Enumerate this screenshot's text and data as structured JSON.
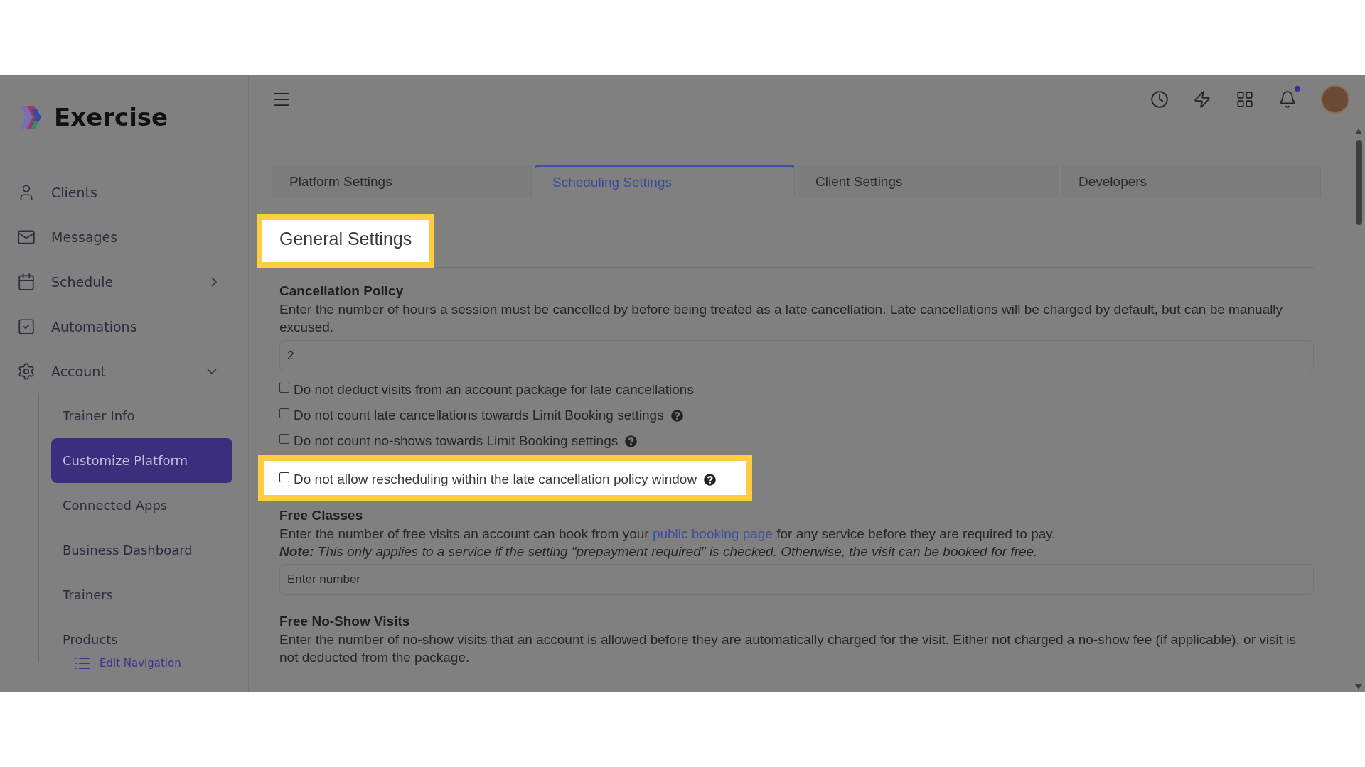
{
  "logo": {
    "text": "Exercise"
  },
  "nav": [
    {
      "label": "Clients",
      "kind": "link"
    },
    {
      "label": "Messages",
      "kind": "link"
    },
    {
      "label": "Schedule",
      "kind": "group",
      "expanded": false
    },
    {
      "label": "Automations",
      "kind": "link"
    },
    {
      "label": "Account",
      "kind": "group",
      "expanded": true,
      "children": [
        {
          "label": "Trainer Info",
          "selected": false
        },
        {
          "label": "Customize Platform",
          "selected": true
        },
        {
          "label": "Connected Apps",
          "selected": false
        },
        {
          "label": "Business Dashboard",
          "selected": false
        },
        {
          "label": "Trainers",
          "selected": false
        },
        {
          "label": "Products",
          "selected": false
        }
      ]
    }
  ],
  "edit_navigation": "Edit Navigation",
  "topbar": {
    "notification_dot": true
  },
  "tabs": [
    {
      "label": "Platform Settings",
      "selected": false
    },
    {
      "label": "Scheduling Settings",
      "selected": true
    },
    {
      "label": "Client Settings",
      "selected": false
    },
    {
      "label": "Developers",
      "selected": false
    }
  ],
  "section": {
    "title": "General Settings",
    "highlighted": true
  },
  "cancellation_policy": {
    "heading": "Cancellation Policy",
    "description": "Enter the number of hours a session must be cancelled by before being treated as a late cancellation. Late cancellations will be charged by default, but can be manually excused.",
    "value": "2",
    "options": [
      {
        "label": "Do not deduct visits from an account package for late cancellations",
        "checked": false,
        "help": false,
        "highlighted": false
      },
      {
        "label": "Do not count late cancellations towards Limit Booking settings",
        "checked": false,
        "help": true,
        "highlighted": false
      },
      {
        "label": "Do not count no-shows towards Limit Booking settings",
        "checked": false,
        "help": true,
        "highlighted": false
      },
      {
        "label": "Do not allow rescheduling within the late cancellation policy window",
        "checked": false,
        "help": true,
        "highlighted": true
      }
    ]
  },
  "free_classes": {
    "heading": "Free Classes",
    "text_before": "Enter the number of free visits an account can book from your ",
    "link": "public booking page",
    "text_after": " for any service before they are required to pay.",
    "note": "**Note:** This only applies to a service if the setting \"prepayment required\" is checked. Otherwise, the visit can be booked for free.",
    "placeholder": "Enter number"
  },
  "free_no_show": {
    "heading": "Free No-Show Visits",
    "description": "Enter the number of no-show visits that an account is allowed before they are automatically charged for the visit. Either not charged a no-show fee (if applicable), or visit is not deducted from the package."
  }
}
